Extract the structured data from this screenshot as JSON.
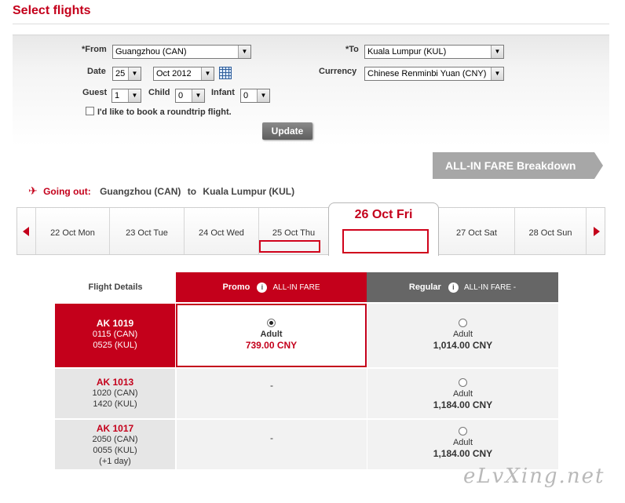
{
  "page": {
    "title": "Select flights"
  },
  "search": {
    "from_label": "*From",
    "from_value": "Guangzhou (CAN)",
    "to_label": "*To",
    "to_value": "Kuala Lumpur (KUL)",
    "date_label": "Date",
    "date_day": "25",
    "date_month": "Oct 2012",
    "currency_label": "Currency",
    "currency_value": "Chinese Renminbi Yuan (CNY)",
    "guest_label": "Guest",
    "guest_value": "1",
    "child_label": "Child",
    "child_value": "0",
    "infant_label": "Infant",
    "infant_value": "0",
    "roundtrip_label": "I'd like to book a roundtrip flight.",
    "roundtrip_checked": false,
    "update_label": "Update"
  },
  "allin_breakdown_label": "ALL-IN FARE Breakdown",
  "going_out": {
    "label": "Going out:",
    "origin": "Guangzhou (CAN)",
    "connector": "to",
    "destination": "Kuala Lumpur (KUL)"
  },
  "date_strip": {
    "days": [
      "22 Oct Mon",
      "23 Oct Tue",
      "24 Oct Wed",
      "25 Oct Thu",
      "26 Oct Fri",
      "27 Oct Sat",
      "28 Oct Sun"
    ],
    "active_index": 4
  },
  "fare_table": {
    "details_header": "Flight Details",
    "promo_header": "Promo",
    "regular_header": "Regular",
    "allin_tag": "ALL-IN FARE",
    "allin_tag_regular": "ALL-IN FARE -",
    "rows": [
      {
        "flight_no": "AK  1019",
        "depart": "0115  (CAN)",
        "arrive": "0525  (KUL)",
        "note": "",
        "promo": {
          "available": true,
          "selected": true,
          "type": "Adult",
          "price": "739.00 CNY"
        },
        "regular": {
          "available": true,
          "selected": false,
          "type": "Adult",
          "price": "1,014.00 CNY"
        },
        "promo_dash": "-"
      },
      {
        "flight_no": "AK  1013",
        "depart": "1020  (CAN)",
        "arrive": "1420  (KUL)",
        "note": "",
        "promo": {
          "available": false,
          "type": "",
          "price": ""
        },
        "regular": {
          "available": true,
          "selected": false,
          "type": "Adult",
          "price": "1,184.00 CNY"
        },
        "promo_dash": "-"
      },
      {
        "flight_no": "AK  1017",
        "depart": "2050  (CAN)",
        "arrive": "0055  (KUL)",
        "note": "(+1 day)",
        "promo": {
          "available": false,
          "type": "",
          "price": ""
        },
        "regular": {
          "available": true,
          "selected": false,
          "type": "Adult",
          "price": "1,184.00 CNY"
        },
        "promo_dash": "-"
      }
    ]
  },
  "watermark": "eLvXing.net",
  "colors": {
    "brand_red": "#c4001b",
    "regular_grey": "#666666",
    "allin_grey": "#a7a7a7"
  }
}
